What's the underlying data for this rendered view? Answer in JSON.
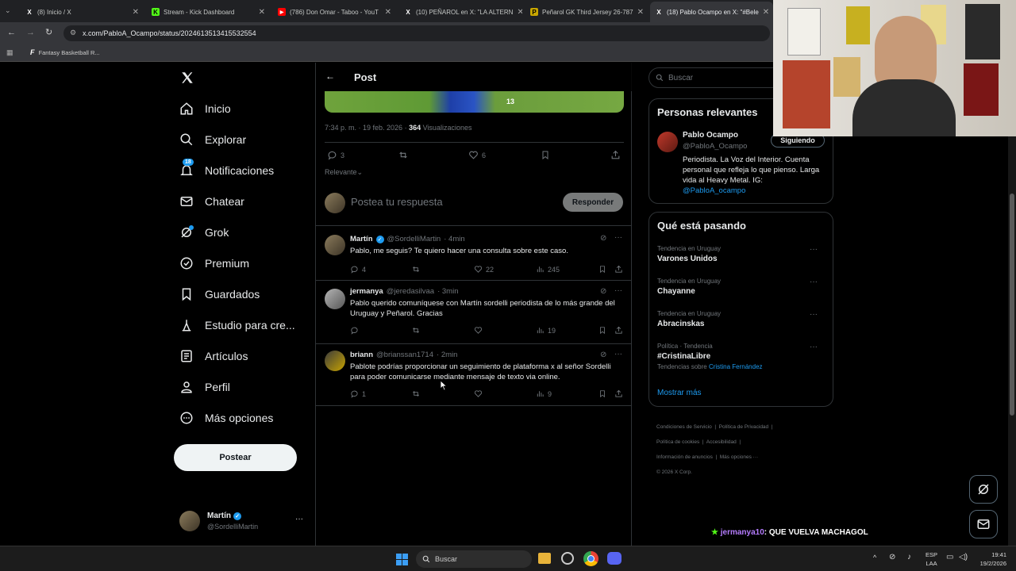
{
  "browser": {
    "tabs": [
      {
        "title": "(8) Inicio / X",
        "fav": "X",
        "fav_color": "#000"
      },
      {
        "title": "Stream - Kick Dashboard",
        "fav": "K",
        "fav_color": "#53fc18"
      },
      {
        "title": "(786) Don Omar - Taboo - YouT",
        "fav": "▶",
        "fav_color": "#ff0000"
      },
      {
        "title": "(10) PEÑAROL en X: \"LA ALTERN",
        "fav": "X",
        "fav_color": "#000"
      },
      {
        "title": "Peñarol GK Third Jersey 26-787",
        "fav": "P",
        "fav_color": "#c8a600"
      },
      {
        "title": "(18) Pablo Ocampo en X: \"#Bele",
        "fav": "X",
        "fav_color": "#000"
      }
    ],
    "url": "x.com/PabloA_Ocampo/status/2024613513415532554",
    "bookmark": "Fantasy Basketball R..."
  },
  "nav": {
    "items": [
      {
        "label": "Inicio",
        "icon": "home-icon"
      },
      {
        "label": "Explorar",
        "icon": "search-icon"
      },
      {
        "label": "Notificaciones",
        "icon": "bell-icon",
        "badge": "18"
      },
      {
        "label": "Chatear",
        "icon": "mail-icon"
      },
      {
        "label": "Grok",
        "icon": "grok-icon"
      },
      {
        "label": "Premium",
        "icon": "premium-icon"
      },
      {
        "label": "Guardados",
        "icon": "bookmark-icon"
      },
      {
        "label": "Estudio para cre...",
        "icon": "studio-icon"
      },
      {
        "label": "Artículos",
        "icon": "article-icon"
      },
      {
        "label": "Perfil",
        "icon": "person-icon"
      },
      {
        "label": "Más opciones",
        "icon": "more-icon"
      }
    ],
    "post_button": "Postear",
    "account": {
      "name": "Martín",
      "handle": "@SordelliMartin"
    }
  },
  "post": {
    "header_title": "Post",
    "meta_time": "7:34 p. m. · 19 feb. 2026 · ",
    "views_count": "364",
    "views_label": " Visualizaciones",
    "replies": "3",
    "likes": "6",
    "sort_label": "Relevante",
    "reply_placeholder": "Postea tu respuesta",
    "reply_button": "Responder"
  },
  "replies": [
    {
      "name": "Martín",
      "verified": true,
      "handle": "@SordelliMartin",
      "time": "· 4min",
      "text": "Pablo, me seguis? Te quiero hacer una consulta sobre este caso.",
      "replies": "4",
      "retweets": "",
      "likes": "22",
      "views": "245"
    },
    {
      "name": "jermanya",
      "verified": false,
      "handle": "@jeredasilvaa",
      "time": "· 3min",
      "text": "Pablo querido comuníquese con Martín sordelli periodista de lo más grande del Uruguay y Peñarol. Gracias",
      "replies": "",
      "retweets": "",
      "likes": "",
      "views": "19"
    },
    {
      "name": "briann",
      "verified": false,
      "handle": "@brianssan1714",
      "time": "· 2min",
      "text": "Pablote podrías proporcionar un seguimiento de plataforma x al señor Sordelli para poder comunicarse mediante mensaje de texto via online.",
      "replies": "1",
      "retweets": "",
      "likes": "",
      "views": "9"
    }
  ],
  "right": {
    "search_placeholder": "Buscar",
    "relevant_title": "Personas relevantes",
    "person": {
      "name": "Pablo Ocampo",
      "handle": "@PabloA_Ocampo",
      "follow_label": "Siguiendo",
      "bio": "Periodista. La Voz del Interior. Cuenta personal que refleja lo que pienso. Larga vida al Heavy Metal. IG:",
      "bio_link": "@PabloA_ocampo"
    },
    "trends_title": "Qué está pasando",
    "trends": [
      {
        "category": "Tendencia en Uruguay",
        "name": "Varones Unidos"
      },
      {
        "category": "Tendencia en Uruguay",
        "name": "Chayanne"
      },
      {
        "category": "Tendencia en Uruguay",
        "name": "Abracinskas"
      },
      {
        "category": "Política · Tendencia",
        "name": "#CristinaLibre",
        "extra": "Tendencias sobre ",
        "extra_link": "Cristina Fernández"
      }
    ],
    "show_more": "Mostrar más",
    "footer": [
      "Condiciones de Servicio",
      "Política de Privacidad",
      "Política de cookies",
      "Accesibilidad",
      "Información de anuncios",
      "Más opciones ···",
      "© 2026 X Corp."
    ]
  },
  "chat_overlay": {
    "user": "jermanya10",
    "message": ": QUE VUELVA MACHAGOL"
  },
  "taskbar": {
    "search": "Buscar",
    "lang1": "ESP",
    "lang2": "LAA",
    "time": "19:41",
    "date": "19/2/2026"
  },
  "colors": {
    "accent": "#1d9bf0",
    "background": "#000000",
    "border": "#2f3336",
    "muted": "#71767b"
  }
}
